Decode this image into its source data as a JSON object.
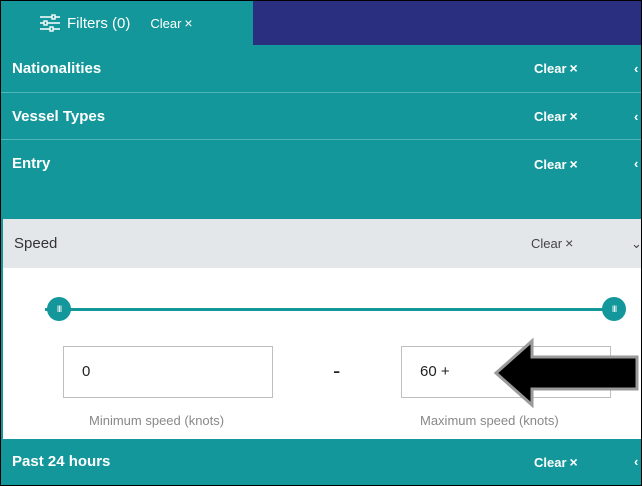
{
  "header": {
    "filters_title": "Filters (0)",
    "clear_label": "Clear"
  },
  "sections": {
    "nationalities": {
      "label": "Nationalities",
      "clear": "Clear"
    },
    "vessel_types": {
      "label": "Vessel Types",
      "clear": "Clear"
    },
    "entry": {
      "label": "Entry",
      "clear": "Clear"
    },
    "speed": {
      "label": "Speed",
      "clear": "Clear"
    },
    "past_24_hours": {
      "label": "Past 24 hours",
      "clear": "Clear"
    }
  },
  "speed_filter": {
    "min_value": "0",
    "max_value": "60 +",
    "separator": "-",
    "min_hint": "Minimum speed (knots)",
    "max_hint": "Maximum speed (knots)",
    "slider_min_fraction": 0,
    "slider_max_fraction": 1
  },
  "icons": {
    "filters": "sliders-icon",
    "clear": "close-x-icon",
    "collapse": "chevron-icon",
    "annotation": "black-arrow-left"
  },
  "colors": {
    "teal": "#14979b",
    "navy": "#2a2f80",
    "speed_header_bg": "#e4e7ea"
  }
}
